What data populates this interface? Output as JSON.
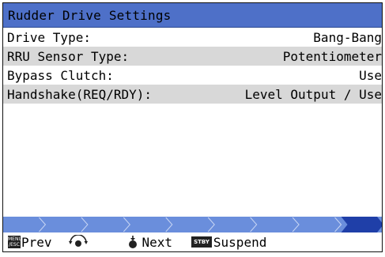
{
  "title": "Rudder Drive Settings",
  "rows": [
    {
      "label": "Drive Type:",
      "value": "Bang-Bang"
    },
    {
      "label": "RRU Sensor Type:",
      "value": "Potentiometer"
    },
    {
      "label": "Bypass Clutch:",
      "value": "Use"
    },
    {
      "label": "Handshake(REQ/RDY):",
      "value": "Level Output / Use"
    }
  ],
  "progress": {
    "segments_total": 9,
    "current_segment": 9
  },
  "footer": {
    "menu_badge_top": "MENU",
    "menu_badge_bottom": "/ESC",
    "prev_label": "Prev",
    "next_label": "Next",
    "stby_badge": "STBY",
    "suspend_label": "Suspend"
  },
  "colors": {
    "title_bg": "#4e70c8",
    "alt_row_bg": "#d8d8d8",
    "progress_bg": "#6a8edc",
    "progress_active": "#1f3fa8"
  },
  "icons": {
    "knob": "rotary-knob-icon",
    "push": "push-knob-icon"
  }
}
